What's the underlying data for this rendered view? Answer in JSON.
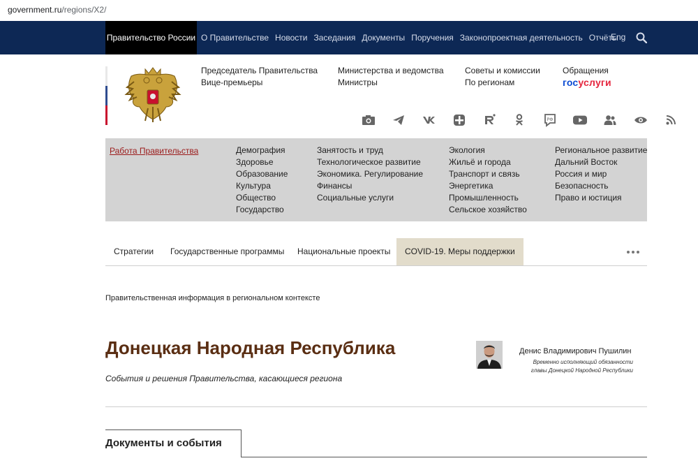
{
  "browser": {
    "url_host": "government.ru",
    "url_path": "/regions/X2/"
  },
  "topnav": {
    "brand": "Правительство России",
    "items": [
      "О Правительстве",
      "Новости",
      "Заседания",
      "Документы",
      "Поручения",
      "Законопроектная деятельность",
      "Отчёты"
    ],
    "lang": "Eng",
    "search_icon": "search-icon",
    "bg_color": "#0d2855"
  },
  "header_links": {
    "col1": [
      "Председатель Правительства",
      "Вице-премьеры"
    ],
    "col2": [
      "Министерства и ведомства",
      "Министры"
    ],
    "col3": [
      "Советы и комиссии",
      "По регионам"
    ],
    "col4": [
      "Обращения"
    ],
    "gosuslugi_a": "гос",
    "gosuslugi_b": "услуги"
  },
  "social_icons": [
    "camera-icon",
    "telegram-icon",
    "vk-icon",
    "plus-icon",
    "rutube-icon",
    "odnoklassniki-icon",
    "rf-chat-icon",
    "youtube-icon",
    "users-icon",
    "eye-icon",
    "rss-icon"
  ],
  "themes": {
    "work_link": "Работа Правительства",
    "col1": [
      "Демография",
      "Здоровье",
      "Образование",
      "Культура",
      "Общество",
      "Государство"
    ],
    "col2": [
      "Занятость и труд",
      "Технологическое развитие",
      "Экономика. Регулирование",
      "Финансы",
      "Социальные услуги"
    ],
    "col3": [
      "Экология",
      "Жильё и города",
      "Транспорт и связь",
      "Энергетика",
      "Промышленность",
      "Сельское хозяйство"
    ],
    "col4": [
      "Региональное развитие",
      "Дальний Восток",
      "Россия и мир",
      "Безопасность",
      "Право и юстиция"
    ]
  },
  "subnav": {
    "tabs": [
      "Стратегии",
      "Государственные программы",
      "Национальные проекты",
      "COVID-19. Меры поддержки"
    ],
    "more_icon": "more-icon"
  },
  "page": {
    "context": "Правительственная информация в региональном контексте",
    "title": "Донецкая Народная Республика",
    "subtitle": "События и решения Правительства, касающиеся региона",
    "head_name": "Денис Владимирович Пушилин",
    "head_role_1": "Временно исполняющий обязанности",
    "head_role_2": "главы Донецкой Народной Республики",
    "docs_tab": "Документы и события"
  }
}
